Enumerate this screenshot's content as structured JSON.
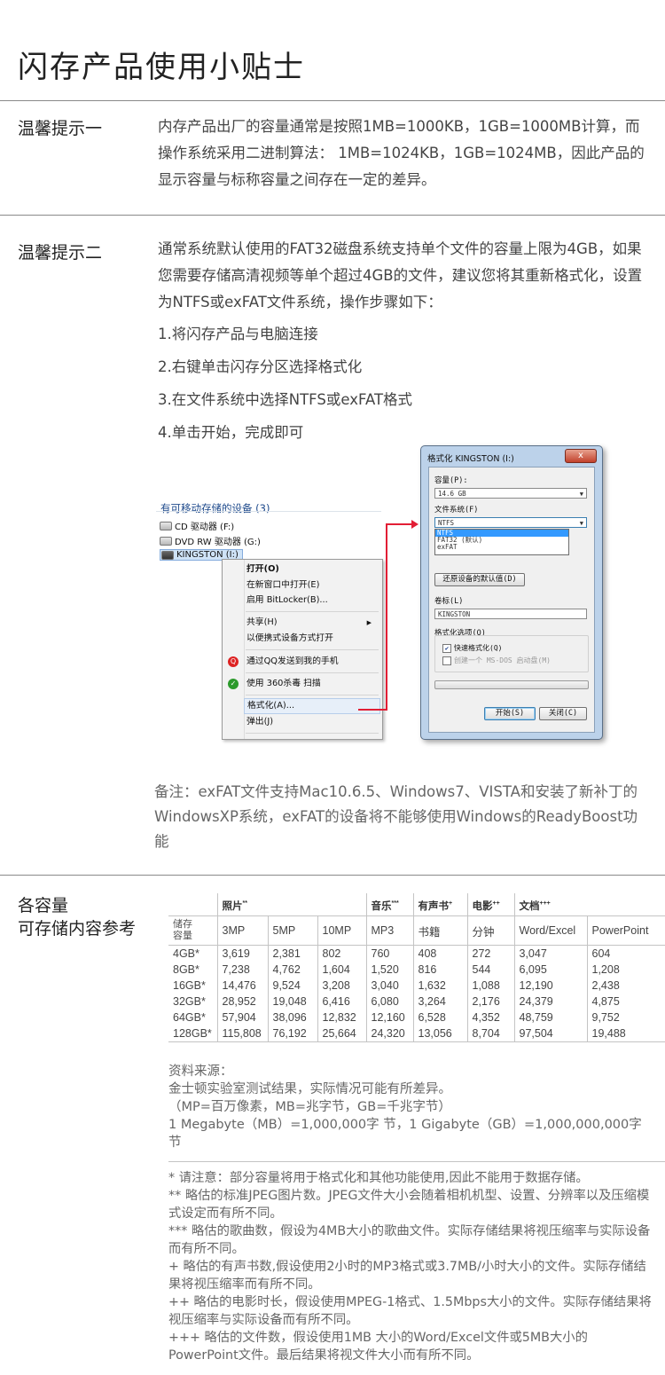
{
  "page": {
    "title": "闪存产品使用小贴士"
  },
  "tip1": {
    "label": "温馨提示一",
    "text": "内存产品出厂的容量通常是按照1MB=1000KB，1GB=1000MB计算，而操作系统采用二进制算法： 1MB=1024KB，1GB=1024MB，因此产品的显示容量与标称容量之间存在一定的差异。"
  },
  "tip2": {
    "label": "温馨提示二",
    "text": "通常系统默认使用的FAT32磁盘系统支持单个文件的容量上限为4GB，如果您需要存储高清视频等单个超过4GB的文件，建议您将其重新格式化，设置为NTFS或exFAT文件系统，操作步骤如下：",
    "steps": [
      "1.将闪存产品与电脑连接",
      "2.右键单击闪存分区选择格式化",
      "3.在文件系统中选择NTFS或exFAT格式",
      "4.单击开始，完成即可"
    ],
    "note": "备注：exFAT文件支持Mac10.6.5、Windows7、VISTA和安装了新补丁的WindowsXP系统，exFAT的设备将不能够使用Windows的ReadyBoost功能"
  },
  "explorer": {
    "group_title": "有可移动存储的设备 (3)",
    "devices": [
      "CD 驱动器 (F:)",
      "DVD RW 驱动器 (G:)",
      "KINGSTON (I:)"
    ],
    "menu": {
      "open": "打开(O)",
      "open_new_window": "在新窗口中打开(E)",
      "bitlocker": "启用 BitLocker(B)...",
      "share": "共享(H)",
      "portable": "以便携式设备方式打开",
      "qq_send": "通过QQ发送到我的手机",
      "scan_360": "使用 360杀毒 扫描",
      "format": "格式化(A)...",
      "eject": "弹出(J)"
    }
  },
  "format_dialog": {
    "title": "格式化 KINGSTON (I:)",
    "close": "x",
    "capacity_label": "容量(P):",
    "capacity_value": "14.6 GB",
    "fs_label": "文件系统(F)",
    "fs_value": "NTFS",
    "fs_options": [
      "NTFS",
      "FAT32 (默认)",
      "exFAT"
    ],
    "restore_button": "还原设备的默认值(D)",
    "volume_label": "卷标(L)",
    "volume_value": "KINGSTON",
    "options_label": "格式化选项(O)",
    "quick_format": "快速格式化(Q)",
    "msdos_disk": "创建一个 MS-DOS 启动盘(M)",
    "start_button": "开始(S)",
    "close_button": "关闭(C)"
  },
  "capacity": {
    "label_line1": "各容量",
    "label_line2": "可存储内容参考",
    "categories": [
      {
        "name": "照片",
        "mark": "**"
      },
      {
        "name": "音乐",
        "mark": "***"
      },
      {
        "name": "有声书",
        "mark": "+"
      },
      {
        "name": "电影",
        "mark": "++"
      },
      {
        "name": "文档",
        "mark": "+++"
      }
    ],
    "row_header": "储存容量",
    "columns": [
      "3MP",
      "5MP",
      "10MP",
      "MP3",
      "书籍",
      "分钟",
      "Word/Excel",
      "PowerPoint"
    ],
    "rows": [
      [
        "4GB*",
        "3,619",
        "2,381",
        "802",
        "760",
        "408",
        "272",
        "3,047",
        "604"
      ],
      [
        "8GB*",
        "7,238",
        "4,762",
        "1,604",
        "1,520",
        "816",
        "544",
        "6,095",
        "1,208"
      ],
      [
        "16GB*",
        "14,476",
        "9,524",
        "3,208",
        "3,040",
        "1,632",
        "1,088",
        "12,190",
        "2,438"
      ],
      [
        "32GB*",
        "28,952",
        "19,048",
        "6,416",
        "6,080",
        "3,264",
        "2,176",
        "24,379",
        "4,875"
      ],
      [
        "64GB*",
        "57,904",
        "38,096",
        "12,832",
        "12,160",
        "6,528",
        "4,352",
        "48,759",
        "9,752"
      ],
      [
        "128GB*",
        "115,808",
        "76,192",
        "25,664",
        "24,320",
        "13,056",
        "8,704",
        "97,504",
        "19,488"
      ]
    ],
    "source": [
      "资料来源：",
      "金士顿实验室测试结果，实际情况可能有所差异。",
      "（MP=百万像素，MB=兆字节，GB=千兆字节）",
      "1 Megabyte（MB）=1,000,000字 节，1 Gigabyte（GB）=1,000,000,000字节"
    ],
    "footnotes": [
      "* 请注意：部分容量将用于格式化和其他功能使用,因此不能用于数据存储。",
      "** 略估的标准JPEG图片数。JPEG文件大小会随着相机机型、设置、分辨率以及压缩模式设定而有所不同。",
      "*** 略估的歌曲数，假设为4MB大小的歌曲文件。实际存储结果将视压缩率与实际设备而有所不同。",
      "+ 略估的有声书数,假设使用2小时的MP3格式或3.7MB/小时大小的文件。实际存储结果将视压缩率而有所不同。",
      "++ 略估的电影时长，假设使用MPEG-1格式、1.5Mbps大小的文件。实际存储结果将视压缩率与实际设备而有所不同。",
      "+++ 略估的文件数，假设使用1MB 大小的Word/Excel文件或5MB大小的PowerPoint文件。最后结果将视文件大小而有所不同。"
    ]
  }
}
